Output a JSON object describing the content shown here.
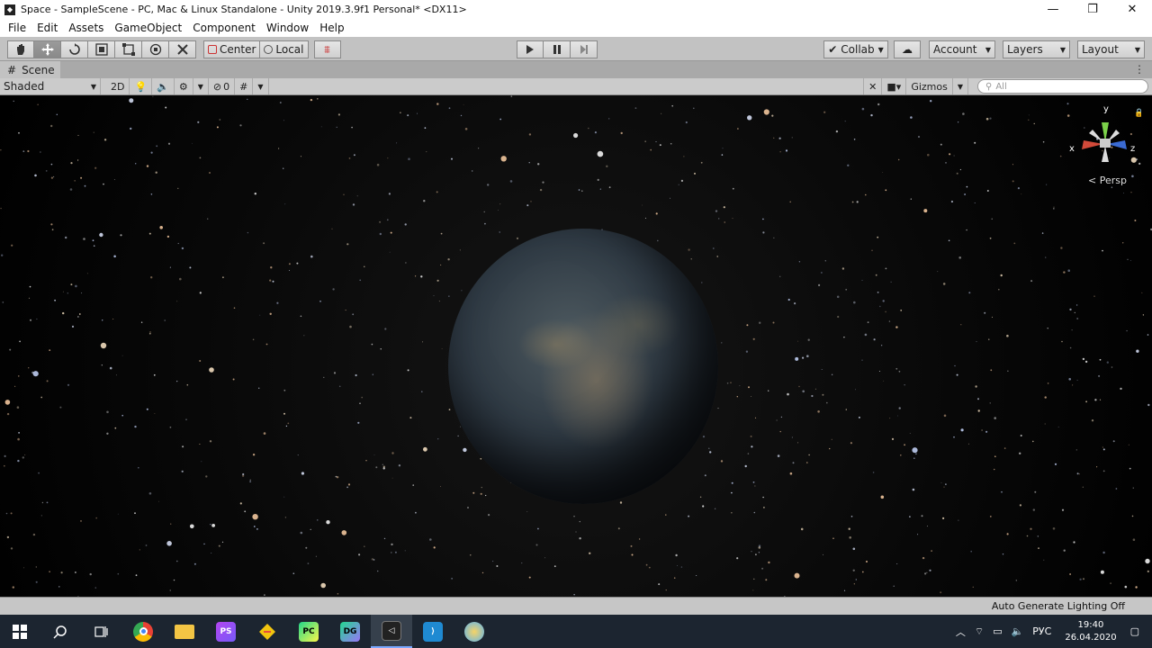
{
  "window": {
    "title": "Space - SampleScene - PC, Mac & Linux Standalone - Unity 2019.3.9f1 Personal* <DX11>",
    "minimize": "—",
    "maximize": "❐",
    "close": "✕"
  },
  "menu": [
    "File",
    "Edit",
    "Assets",
    "GameObject",
    "Component",
    "Window",
    "Help"
  ],
  "toolbar": {
    "pivot_mode": "Center",
    "pivot_rotation": "Local",
    "collab": "Collab",
    "account": "Account",
    "layers": "Layers",
    "layout": "Layout"
  },
  "scene_tab": {
    "label": "Scene"
  },
  "scene_bar": {
    "shading": "Shaded",
    "mode_2d": "2D",
    "hidden_count": "0",
    "gizmos": "Gizmos",
    "search_placeholder": "All"
  },
  "viewport": {
    "gizmo_axes": [
      "y",
      "x",
      "z"
    ],
    "projection": "Persp"
  },
  "status": {
    "text": "Auto Generate Lighting Off"
  },
  "taskbar": {
    "language": "РУС",
    "time": "19:40",
    "date": "26.04.2020"
  }
}
